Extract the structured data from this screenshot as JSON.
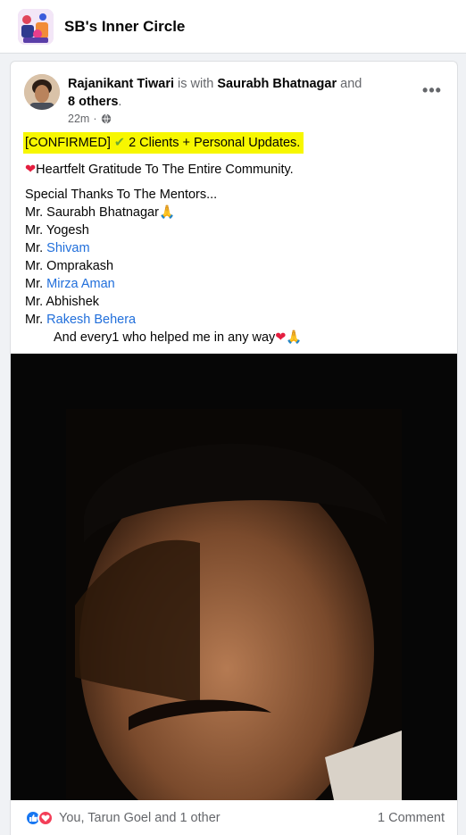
{
  "group": {
    "name": "SB's Inner Circle",
    "avatar_icon": "group-illustration-icon"
  },
  "post": {
    "author": "Rajanikant Tiwari",
    "with_text": "is with",
    "tagged_person": "Saurabh Bhatnagar",
    "and_text": "and",
    "others": "8 others",
    "period": ".",
    "time": "22m",
    "time_sep": "·",
    "audience_icon": "globe-icon",
    "more_label": "•••",
    "headline_prefix": "[CONFIRMED]",
    "headline_check": "✔",
    "headline_text": "2 Clients + Personal Updates.",
    "gratitude_heart": "❤",
    "gratitude_text": "Heartfelt Gratitude To The Entire Community.",
    "thanks_intro": "Special Thanks To The Mentors...",
    "mentors": [
      {
        "prefix": "Mr.",
        "name": "Saurabh Bhatnagar",
        "suffix": "🙏"
      },
      {
        "prefix": "Mr.",
        "name": "Yogesh",
        "suffix": ""
      },
      {
        "prefix": "Mr.",
        "name": "Shivam",
        "suffix": ""
      },
      {
        "prefix": "Mr.",
        "name": "Omprakash",
        "suffix": ""
      },
      {
        "prefix": "Mr.",
        "name": "Mirza Aman",
        "suffix": ""
      },
      {
        "prefix": "Mr.",
        "name": "Abhishek",
        "suffix": ""
      },
      {
        "prefix": "Mr.",
        "name": "Rakesh Behera",
        "suffix": ""
      }
    ],
    "closing_text": "And every1 who helped me in any way",
    "closing_heart": "❤",
    "closing_pray": "🙏",
    "video_icon": "video-thumbnail",
    "reactions": {
      "like_icon": "like-icon",
      "love_icon": "love-icon",
      "text": "You, Tarun Goel and 1 other"
    },
    "comments_count": "1 Comment"
  },
  "colors": {
    "link": "#216fdb",
    "highlight": "#f7f700",
    "like": "#1877f2",
    "love": "#f33e58"
  }
}
